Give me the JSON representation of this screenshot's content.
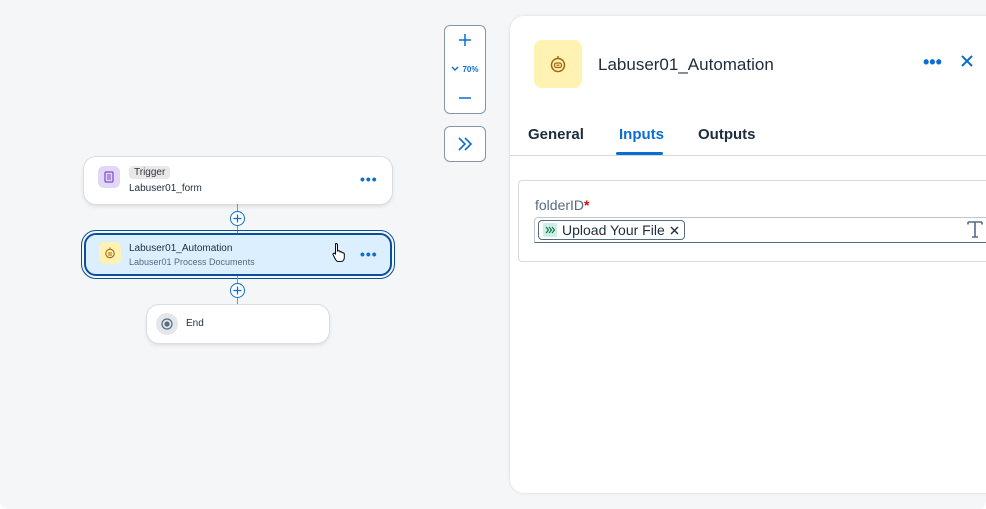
{
  "zoom": {
    "level": "70%"
  },
  "flow": {
    "trigger": {
      "tag": "Trigger",
      "name": "Labuser01_form"
    },
    "automation": {
      "name": "Labuser01_Automation",
      "subtitle": "Labuser01 Process Documents"
    },
    "end": {
      "label": "End"
    }
  },
  "panel": {
    "title": "Labuser01_Automation",
    "tabs": [
      "General",
      "Inputs",
      "Outputs"
    ],
    "active_tab": "Inputs",
    "field": {
      "label": "folderID",
      "required_marker": "*",
      "token": "Upload Your File"
    }
  },
  "colors": {
    "accent": "#0a6ed1",
    "selected_node_bg": "#dcefff",
    "automation_icon_bg": "#fff2b3",
    "trigger_icon_bg": "#e3d7f7",
    "required": "#d20a0a"
  }
}
